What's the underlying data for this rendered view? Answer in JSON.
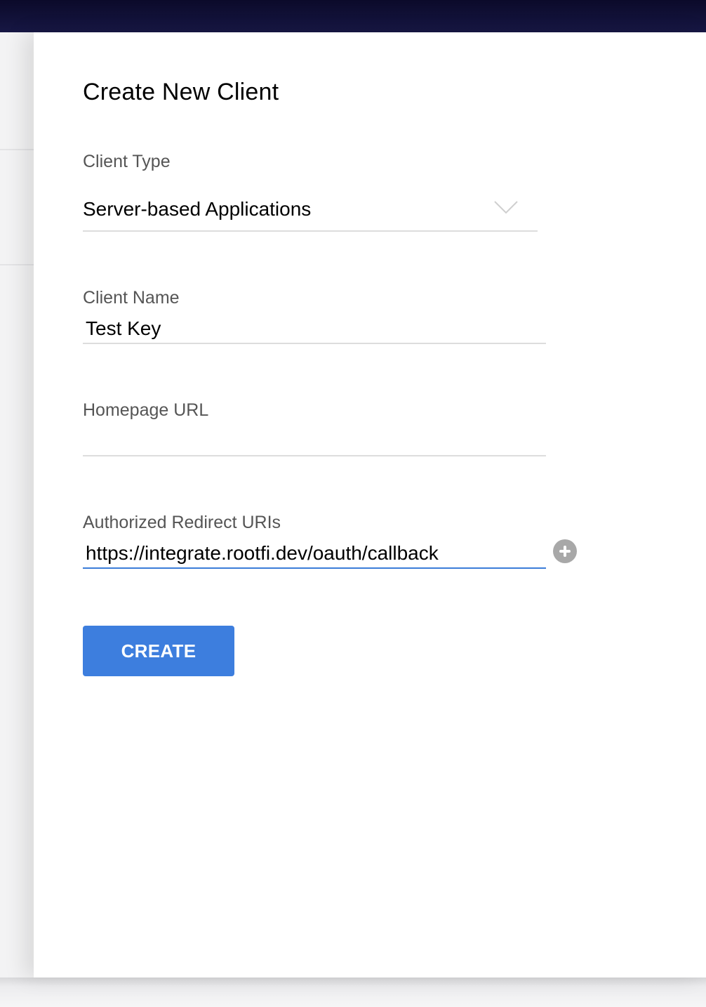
{
  "dialog": {
    "title": "Create New Client"
  },
  "client_type": {
    "label": "Client Type",
    "selected_value": "Server-based Applications"
  },
  "client_name": {
    "label": "Client Name",
    "value": "Test Key"
  },
  "homepage_url": {
    "label": "Homepage URL",
    "value": ""
  },
  "redirect_uris": {
    "label": "Authorized Redirect URIs",
    "value": "https://integrate.rootfi.dev/oauth/callback"
  },
  "actions": {
    "create_label": "CREATE"
  },
  "colors": {
    "primary": "#3d7ede",
    "focus_underline": "#3b7dd8",
    "topbar": "#0b0a2a"
  }
}
